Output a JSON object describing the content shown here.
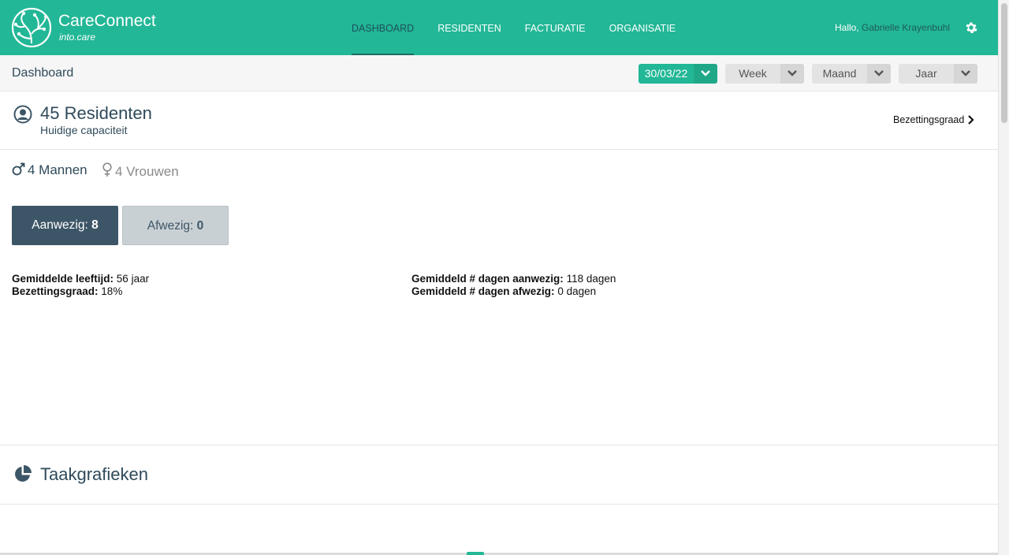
{
  "app": {
    "brand_name": "CareConnect",
    "brand_sub": "into.care",
    "accent_color": "#22b796"
  },
  "nav": {
    "items": [
      {
        "label": "DASHBOARD",
        "active": true
      },
      {
        "label": "RESIDENTEN",
        "active": false
      },
      {
        "label": "FACTURATIE",
        "active": false
      },
      {
        "label": "ORGANISATIE",
        "active": false
      }
    ]
  },
  "user": {
    "greeting": "Hallo,",
    "name": "Gabrielle Krayenbuhl",
    "settings_icon": "gear-icon"
  },
  "subbar": {
    "title": "Dashboard",
    "date_select": "30/03/22",
    "week_select": "Week",
    "month_select": "Maand",
    "year_select": "Jaar"
  },
  "residents": {
    "title": "45 Residenten",
    "subtitle": "Huidige capaciteit",
    "occupancy_link": "Bezettingsgraad",
    "male_label": "4 Mannen",
    "female_label": "4 Vrouwen",
    "present_label": "Aanwezig:",
    "present_count": "8",
    "absent_label": "Afwezig:",
    "absent_count": "0"
  },
  "stats": {
    "avg_age_label": "Gemiddelde leeftijd:",
    "avg_age_value": "56 jaar",
    "occupancy_label": "Bezettingsgraad:",
    "occupancy_value": "18%",
    "avg_days_present_label": "Gemiddeld # dagen aanwezig:",
    "avg_days_present_value": "118 dagen",
    "avg_days_absent_label": "Gemiddeld # dagen afwezig:",
    "avg_days_absent_value": "0 dagen"
  },
  "tasks": {
    "title": "Taakgrafieken"
  }
}
